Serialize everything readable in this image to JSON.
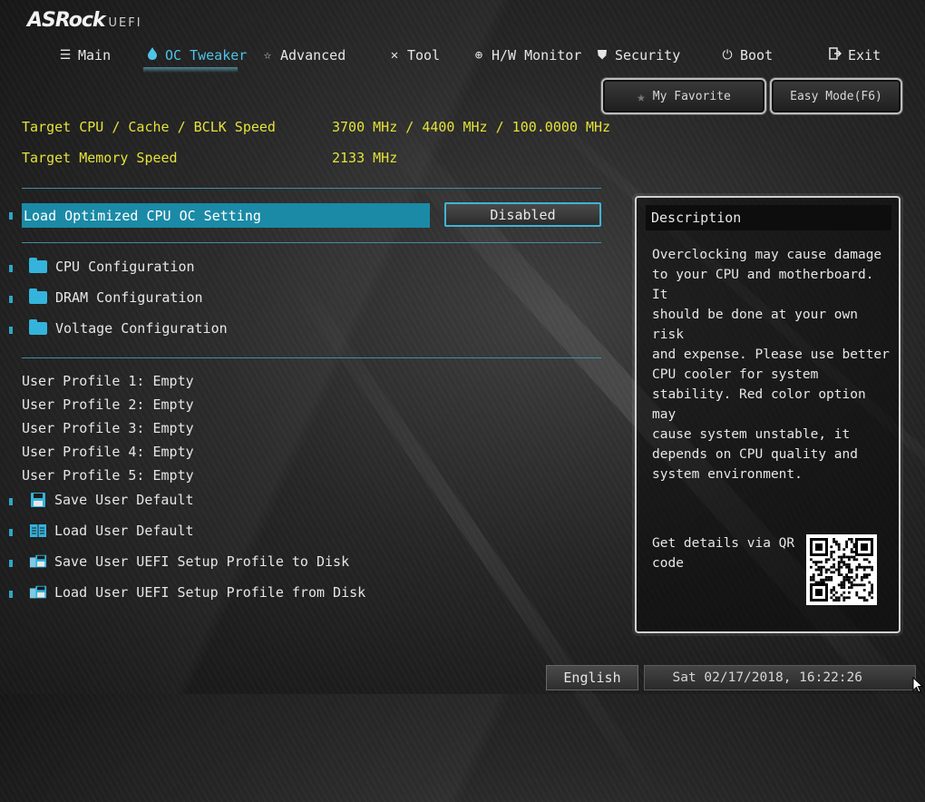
{
  "brand": {
    "name": "ASRock",
    "suffix": "UEFI"
  },
  "nav": [
    {
      "label": "Main",
      "icon": "list-icon",
      "active": false
    },
    {
      "label": "OC Tweaker",
      "icon": "flame-icon",
      "active": true
    },
    {
      "label": "Advanced",
      "icon": "star-icon",
      "active": false
    },
    {
      "label": "Tool",
      "icon": "tools-icon",
      "active": false
    },
    {
      "label": "H/W Monitor",
      "icon": "crosshair-icon",
      "active": false
    },
    {
      "label": "Security",
      "icon": "shield-icon",
      "active": false
    },
    {
      "label": "Boot",
      "icon": "power-icon",
      "active": false
    },
    {
      "label": "Exit",
      "icon": "exit-icon",
      "active": false
    }
  ],
  "buttons": {
    "favorite": "My Favorite",
    "easy_mode": "Easy Mode(F6)"
  },
  "info": [
    {
      "label": "Target CPU / Cache / BCLK Speed",
      "value": "3700 MHz / 4400 MHz / 100.0000 MHz"
    },
    {
      "label": "Target Memory Speed",
      "value": "2133 MHz"
    }
  ],
  "setting": {
    "label": "Load Optimized CPU OC Setting",
    "value": "Disabled"
  },
  "folders": [
    "CPU Configuration",
    "DRAM Configuration",
    "Voltage Configuration"
  ],
  "profiles": [
    "User Profile 1: Empty",
    "User Profile 2: Empty",
    "User Profile 3: Empty",
    "User Profile 4: Empty",
    "User Profile 5: Empty"
  ],
  "actions": [
    {
      "label": "Save User Default",
      "icon": "floppy-icon"
    },
    {
      "label": "Load User Default",
      "icon": "book-icon"
    },
    {
      "label": "Save User UEFI Setup Profile to Disk",
      "icon": "save-disk-icon"
    },
    {
      "label": "Load User UEFI Setup Profile from Disk",
      "icon": "load-disk-icon"
    }
  ],
  "description": {
    "title": "Description",
    "lines": [
      "Overclocking may cause damage",
      "to your CPU and motherboard. It",
      "should be done at your own risk",
      "and expense. Please use better",
      "CPU cooler for system",
      "stability. Red color option may",
      "cause system unstable, it",
      "depends on CPU quality and",
      "system environment."
    ],
    "qr_lines": [
      "Get details via QR",
      "code"
    ]
  },
  "footer": {
    "language": "English",
    "datetime": "Sat 02/17/2018, 16:22:26"
  },
  "colors": {
    "accent": "#34b3dc",
    "highlight": "#1b8aa6",
    "info_text": "#e4e23a"
  }
}
